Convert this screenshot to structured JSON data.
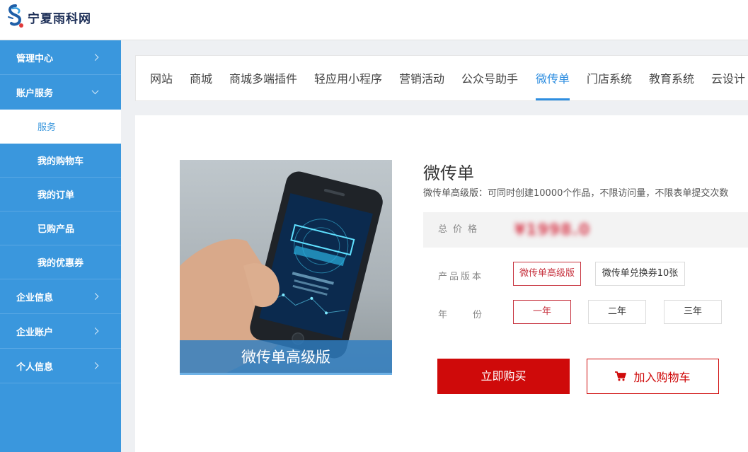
{
  "header": {
    "logo_text": "宁夏雨科网",
    "logo_icon": "logo-icon"
  },
  "sidebar": {
    "items": [
      {
        "label": "管理中心",
        "icon": "chevron-right-icon"
      },
      {
        "label": "账户服务",
        "icon": "chevron-down-icon"
      },
      {
        "label": "服务",
        "active": true
      },
      {
        "label": "我的购物车"
      },
      {
        "label": "我的订单"
      },
      {
        "label": "已购产品"
      },
      {
        "label": "我的优惠券"
      },
      {
        "label": "企业信息",
        "icon": "chevron-right-icon"
      },
      {
        "label": "企业账户",
        "icon": "chevron-right-icon"
      },
      {
        "label": "个人信息",
        "icon": "chevron-right-icon"
      }
    ]
  },
  "tabs": [
    "网站",
    "商城",
    "商城多端插件",
    "轻应用小程序",
    "营销活动",
    "公众号助手",
    "微传单",
    "门店系统",
    "教育系统",
    "云设计"
  ],
  "active_tab": "微传单",
  "product": {
    "image_caption": "微传单高级版",
    "title": "微传单",
    "description": "微传单高级版：可同时创建10000个作品，不限访问量，不限表单提交次数",
    "price_label": "总价格",
    "price_value": "¥1998.0",
    "version_label": "产品版本",
    "versions": [
      "微传单高级版",
      "微传单兑换券10张"
    ],
    "selected_version": "微传单高级版",
    "year_label": "年份",
    "years": [
      "一年",
      "二年",
      "三年"
    ],
    "selected_year": "一年",
    "buy_label": "立即购买",
    "cart_label": "加入购物车",
    "cart_icon": "shopping-cart-icon"
  },
  "colors": {
    "sidebar": "#3a97dd",
    "accent": "#2e8ee0",
    "buy": "#cf0a0a",
    "selected_option": "#c7333f"
  }
}
